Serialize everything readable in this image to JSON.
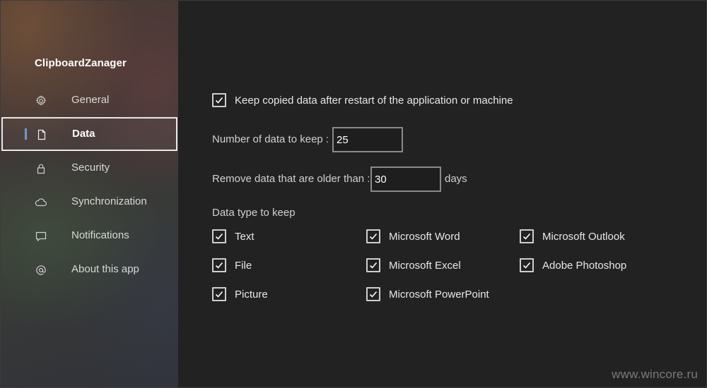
{
  "app": {
    "title": "ClipboardZanager"
  },
  "sidebar": {
    "items": [
      {
        "label": "General",
        "icon": "gear-icon"
      },
      {
        "label": "Data",
        "icon": "document-icon",
        "active": true
      },
      {
        "label": "Security",
        "icon": "lock-icon"
      },
      {
        "label": "Synchronization",
        "icon": "cloud-icon"
      },
      {
        "label": "Notifications",
        "icon": "message-icon"
      },
      {
        "label": "About this app",
        "icon": "at-icon"
      }
    ]
  },
  "data_settings": {
    "keep_after_restart": {
      "label": "Keep copied data after restart of the application or machine",
      "checked": true
    },
    "number_to_keep": {
      "label": "Number of data to keep :",
      "value": "25"
    },
    "remove_older": {
      "label": "Remove data that are older than :",
      "value": "30",
      "unit": "days"
    },
    "types_heading": "Data type to keep",
    "types": [
      {
        "label": "Text",
        "checked": true
      },
      {
        "label": "Microsoft Word",
        "checked": true
      },
      {
        "label": "Microsoft Outlook",
        "checked": true
      },
      {
        "label": "File",
        "checked": true
      },
      {
        "label": "Microsoft Excel",
        "checked": true
      },
      {
        "label": "Adobe Photoshop",
        "checked": true
      },
      {
        "label": "Picture",
        "checked": true
      },
      {
        "label": "Microsoft PowerPoint",
        "checked": true
      }
    ]
  },
  "watermark": "www.wincore.ru",
  "colors": {
    "accent_indicator": "#6a9bd1",
    "background": "#222222"
  }
}
